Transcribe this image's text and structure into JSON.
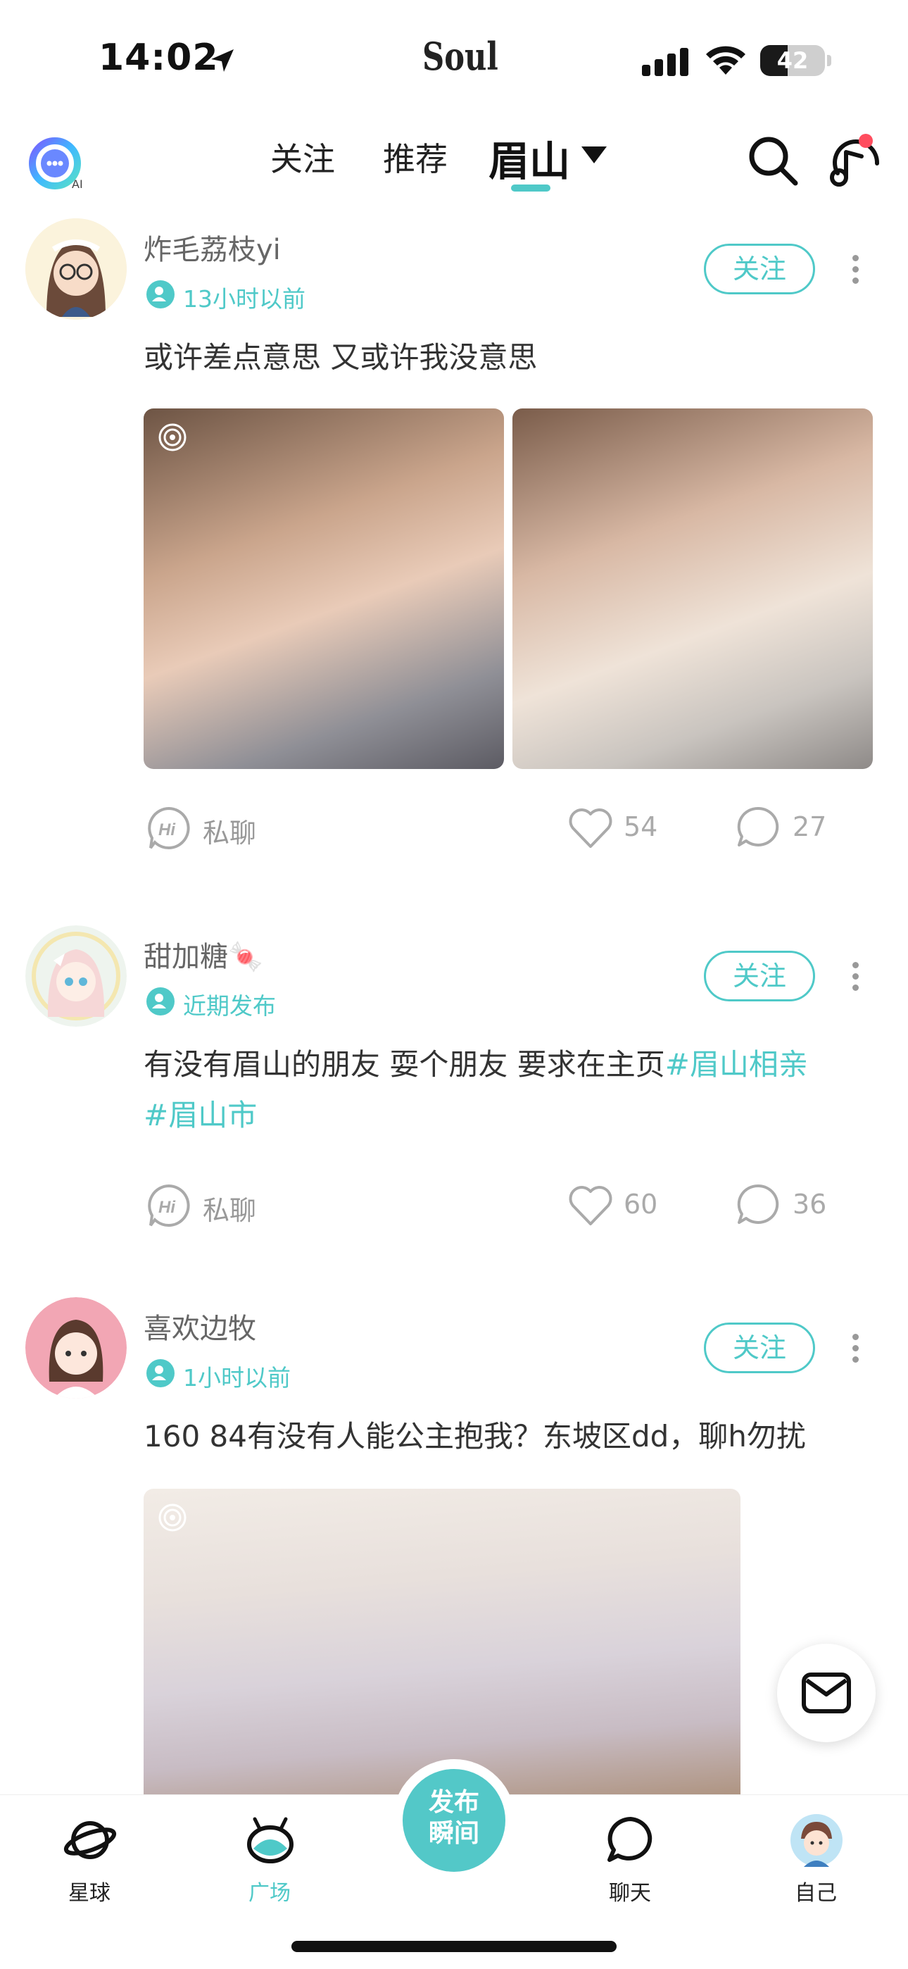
{
  "status_bar": {
    "time": "14:02",
    "carrier": "Soul",
    "battery": "42",
    "battery_level": 0.42
  },
  "top_nav": {
    "ai_label": "AI",
    "tabs": [
      {
        "label": "关注"
      },
      {
        "label": "推荐"
      },
      {
        "label": "眉山"
      }
    ],
    "active_tab": "眉山"
  },
  "posts": [
    {
      "username": "炸毛荔枝yi",
      "time": "13小时以前",
      "follow_label": "关注",
      "text": "或许差点意思 又或许我没意思",
      "chat_label": "私聊",
      "likes": "54",
      "comments": "27"
    },
    {
      "username": "甜加糖🍬",
      "time": "近期发布",
      "follow_label": "关注",
      "text": "有没有眉山的朋友 耍个朋友 要求在主页",
      "tags": [
        "#眉山相亲",
        "#眉山市"
      ],
      "chat_label": "私聊",
      "likes": "60",
      "comments": "36"
    },
    {
      "username": "喜欢边牧",
      "time": "1小时以前",
      "follow_label": "关注",
      "text": "160 84有没有人能公主抱我？东坡区dd，聊h勿扰"
    }
  ],
  "bottom_tabs": [
    {
      "label": "星球"
    },
    {
      "label": "广场"
    },
    {
      "label": "聊天"
    },
    {
      "label": "自己"
    }
  ],
  "active_bottom_tab": "广场",
  "publish_button": {
    "line1": "发布",
    "line2": "瞬间"
  },
  "colors": {
    "accent": "#4fc9c8",
    "publish": "#53c8c8"
  }
}
